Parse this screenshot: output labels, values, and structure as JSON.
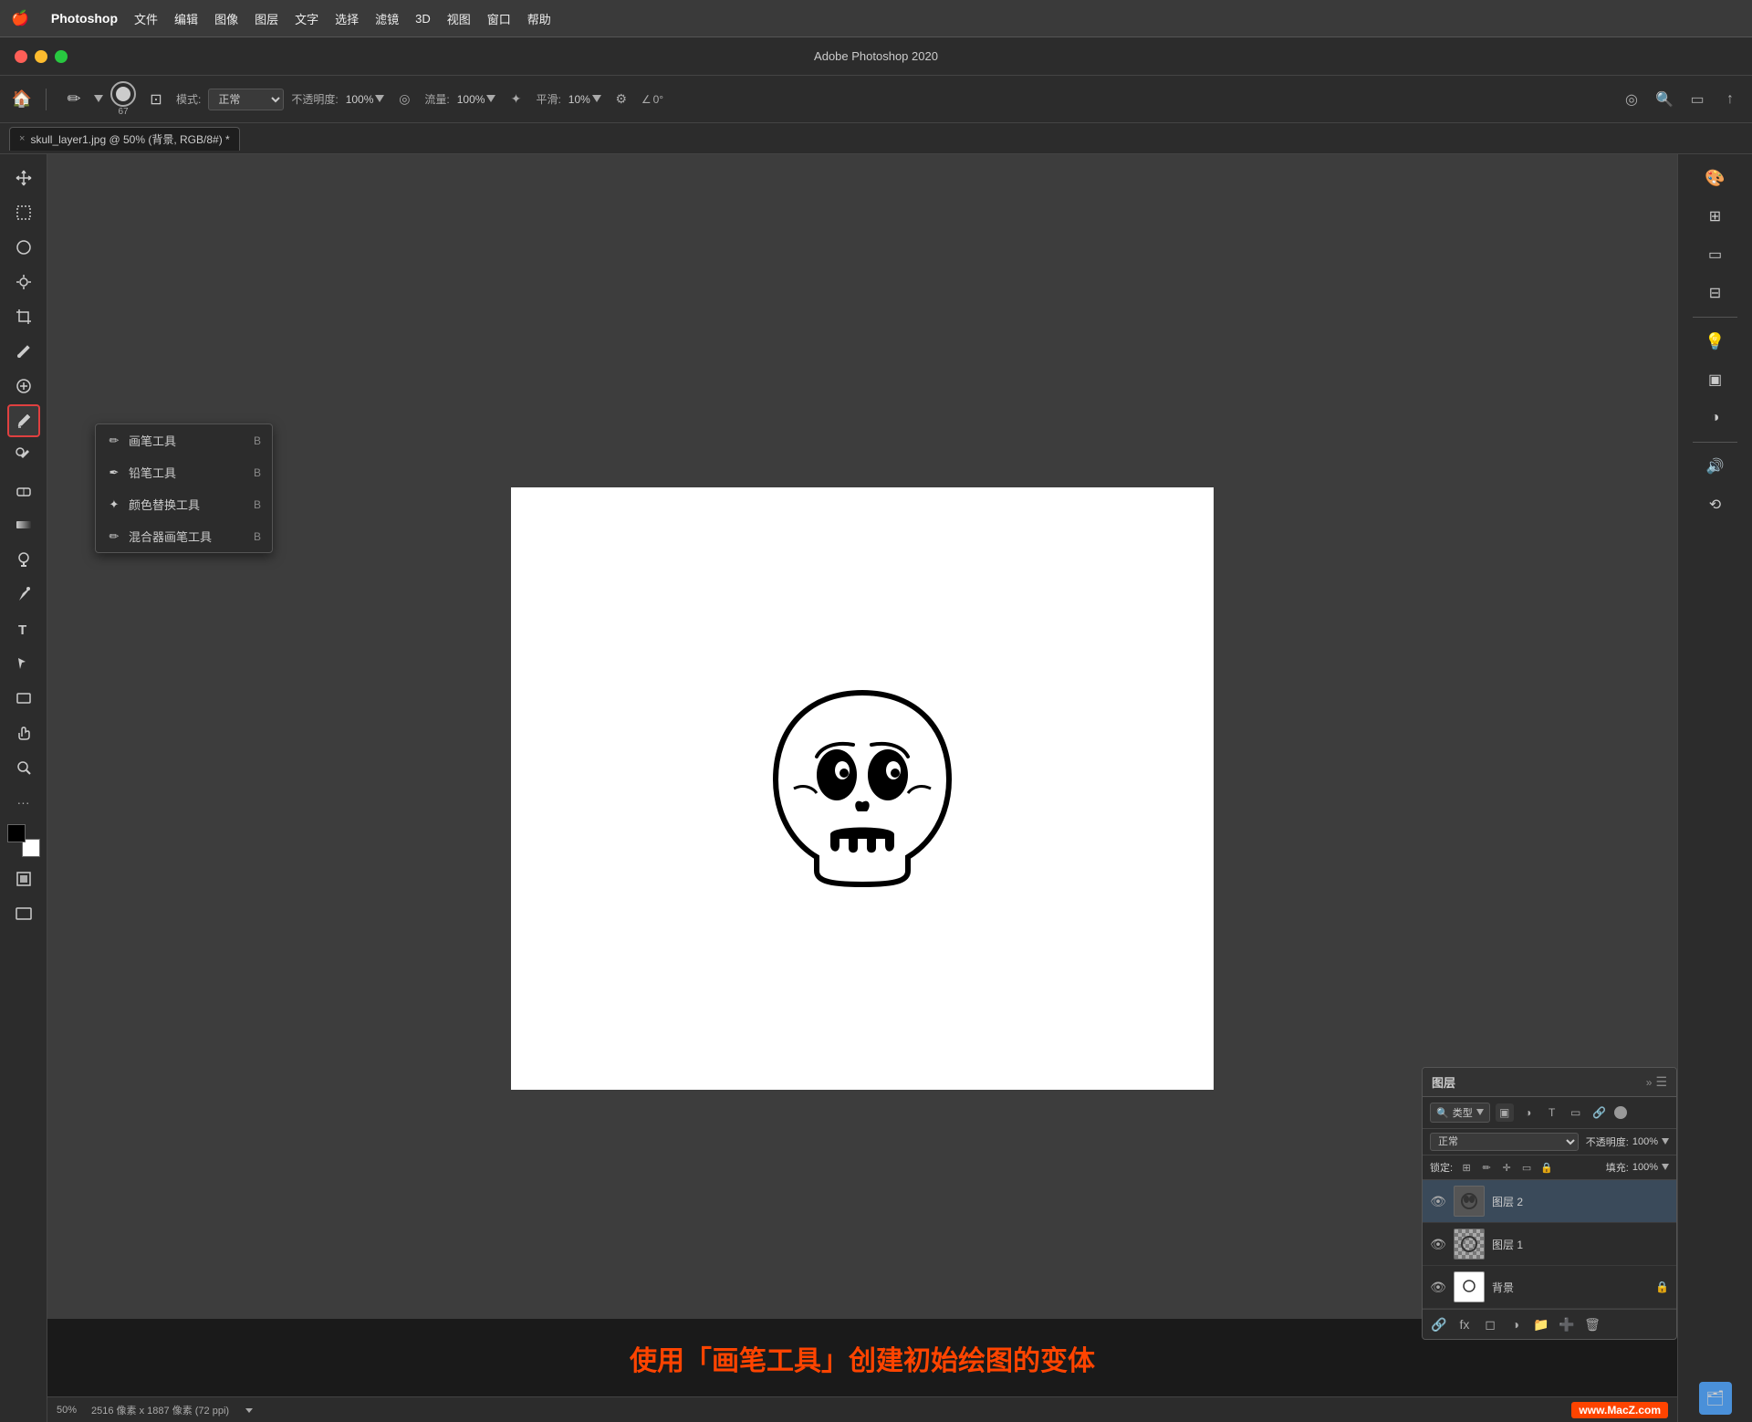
{
  "menubar": {
    "apple": "🍎",
    "app_name": "Photoshop",
    "items": [
      "文件",
      "编辑",
      "图像",
      "图层",
      "文字",
      "选择",
      "滤镜",
      "3D",
      "视图",
      "窗口",
      "帮助"
    ]
  },
  "titlebar": {
    "title": "Adobe Photoshop 2020"
  },
  "toolbar": {
    "brush_size": "67",
    "mode_label": "模式:",
    "mode_value": "正常",
    "opacity_label": "不透明度:",
    "opacity_value": "100%",
    "flow_label": "流量:",
    "flow_value": "100%",
    "smooth_label": "平滑:",
    "smooth_value": "10%",
    "angle_value": "0°"
  },
  "tab": {
    "close_icon": "×",
    "title": "skull_layer1.jpg @ 50% (背景, RGB/8#) *"
  },
  "tools": {
    "move": "✛",
    "marquee": "□",
    "lasso": "◌",
    "magic_wand": "✦",
    "crop": "⊡",
    "eyedropper": "✒",
    "heal": "✚",
    "brush": "✏",
    "clone": "🖂",
    "eraser": "◻",
    "gradient": "▦",
    "dodge": "◑",
    "pen": "✒",
    "text": "T",
    "path_select": "↖",
    "rect_shape": "▭",
    "hand": "✋",
    "zoom": "🔍",
    "more": "...",
    "foreground": "■",
    "background": "□"
  },
  "context_menu": {
    "items": [
      {
        "icon": "✏",
        "label": "画笔工具",
        "shortcut": "B"
      },
      {
        "icon": "✒",
        "label": "铅笔工具",
        "shortcut": "B"
      },
      {
        "icon": "✦",
        "label": "颜色替换工具",
        "shortcut": "B"
      },
      {
        "icon": "✏",
        "label": "混合器画笔工具",
        "shortcut": "B"
      }
    ]
  },
  "layers_panel": {
    "title": "图层",
    "filter_label": "类型",
    "blend_mode": "正常",
    "opacity_label": "不透明度:",
    "opacity_value": "100%",
    "lock_label": "锁定:",
    "fill_label": "填充:",
    "fill_value": "100%",
    "layers": [
      {
        "name": "图层 2",
        "visible": true,
        "locked": false
      },
      {
        "name": "图层 1",
        "visible": true,
        "locked": false
      },
      {
        "name": "背景",
        "visible": true,
        "locked": true
      }
    ]
  },
  "status_bar": {
    "zoom": "50%",
    "size": "2516 像素 x 1887 像素 (72 ppi)"
  },
  "bottom_instruction": "使用「画笔工具」创建初始绘图的变体",
  "watermark": "www.MacZ.com",
  "right_panel_icons": [
    "🎨",
    "⊞",
    "▭",
    "⊟",
    "💡",
    "▣",
    "◑",
    "🔊",
    "⟲"
  ]
}
